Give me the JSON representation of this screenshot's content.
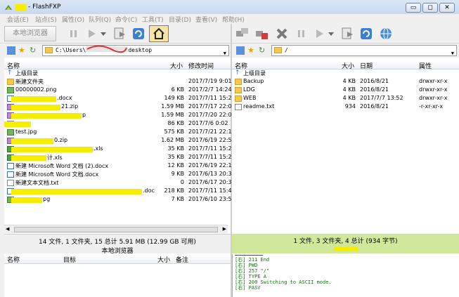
{
  "window": {
    "title": "- FlashFXP",
    "minimize": "▭",
    "maximize": "◻",
    "close": "✕"
  },
  "menu": [
    "会话(E)",
    "站点(S)",
    "属性(O)",
    "队列(Q)",
    "命令(C)",
    "工具(T)",
    "目录(D)",
    "查看(V)",
    "帮助(H)"
  ],
  "toolbar": {
    "local_browser": "本地浏览器"
  },
  "left": {
    "path": "C:\\Users\\",
    "path_tail": "desktop",
    "columns": {
      "name": "名称",
      "size": "大小",
      "modified": "修改时间"
    },
    "files": [
      {
        "name": "上级目录",
        "size": "",
        "modified": "",
        "icon": "up-icon"
      },
      {
        "name": "新建文件夹",
        "size": "",
        "modified": "2017/7/19 9:01",
        "icon": "folder-icon"
      },
      {
        "name": "00000002.png",
        "size": "6 KB",
        "modified": "2017/2/7 14:24",
        "icon": "image-icon"
      },
      {
        "name": ".docx",
        "size": "149 KB",
        "modified": "2017/7/11 15:2",
        "icon": "word-icon"
      },
      {
        "name": "21.zip",
        "size": "1.59 MB",
        "modified": "2017/7/17 22:0",
        "icon": "archive-icon"
      },
      {
        "name": "p",
        "size": "1.59 MB",
        "modified": "2017/7/20 22:0",
        "icon": "archive-icon"
      },
      {
        "name": "",
        "size": "86 KB",
        "modified": "2017/7/6 0:02",
        "icon": "file-icon"
      },
      {
        "name": "test.jpg",
        "size": "575 KB",
        "modified": "2017/7/21 22:1",
        "icon": "image-icon"
      },
      {
        "name": "0.zip",
        "size": "1.62 MB",
        "modified": "2017/6/19 22:5",
        "icon": "archive-icon"
      },
      {
        "name": ".xls",
        "size": "35 KB",
        "modified": "2017/7/11 15:2",
        "icon": "excel-icon"
      },
      {
        "name": "计.xls",
        "size": "35 KB",
        "modified": "2017/7/11 15:2",
        "icon": "excel-icon"
      },
      {
        "name": "新建 Microsoft Word 文档 (2).docx",
        "size": "12 KB",
        "modified": "2017/6/19 22:1",
        "icon": "word-icon"
      },
      {
        "name": "新建 Microsoft Word 文档.docx",
        "size": "9 KB",
        "modified": "2017/6/13 20:3",
        "icon": "word-icon"
      },
      {
        "name": "新建文本文档.txt",
        "size": "0",
        "modified": "2017/6/17 20:3",
        "icon": "text-icon"
      },
      {
        "name": ".doc",
        "size": "218 KB",
        "modified": "2017/7/11 15:4",
        "icon": "word-icon"
      },
      {
        "name": "pg",
        "size": "7 KB",
        "modified": "2017/6/10 23:5",
        "icon": "image-icon"
      }
    ],
    "status": "14 文件, 1 文件夹, 15 总计 5.91 MB (12.99 GB 可用)",
    "status_label": "本地浏览器"
  },
  "right": {
    "path": "/",
    "columns": {
      "name": "名称",
      "size": "大小",
      "date": "日期",
      "attr": "属性"
    },
    "files": [
      {
        "name": "上级目录",
        "size": "",
        "date": "",
        "attr": "",
        "icon": "up-icon"
      },
      {
        "name": "Backup",
        "size": "4 KB",
        "date": "2016/8/21",
        "attr": "drwxr-xr-x",
        "icon": "folder-icon"
      },
      {
        "name": "LDG",
        "size": "4 KB",
        "date": "2016/8/21",
        "attr": "drwxr-xr-x",
        "icon": "folder-icon"
      },
      {
        "name": "WEB",
        "size": "4 KB",
        "date": "2017/7/7 13:52",
        "attr": "drwxr-xr-x",
        "icon": "folder-icon"
      },
      {
        "name": "readme.txt",
        "size": "934",
        "date": "2016/8/21",
        "attr": "-r-xr-xr-x",
        "icon": "text-icon"
      }
    ],
    "status": "1 文件, 3 文件夹, 4 总计 (934 字节)"
  },
  "queue": {
    "columns": {
      "name": "名称",
      "target": "目标",
      "size": "大小",
      "remark": "备注"
    }
  },
  "log": [
    "[右] 211 End",
    "[右] PWD",
    "[右] 257 \"/\"",
    "[右] TYPE A",
    "[右] 200 Switching to ASCII mode.",
    "[右] PASV"
  ]
}
